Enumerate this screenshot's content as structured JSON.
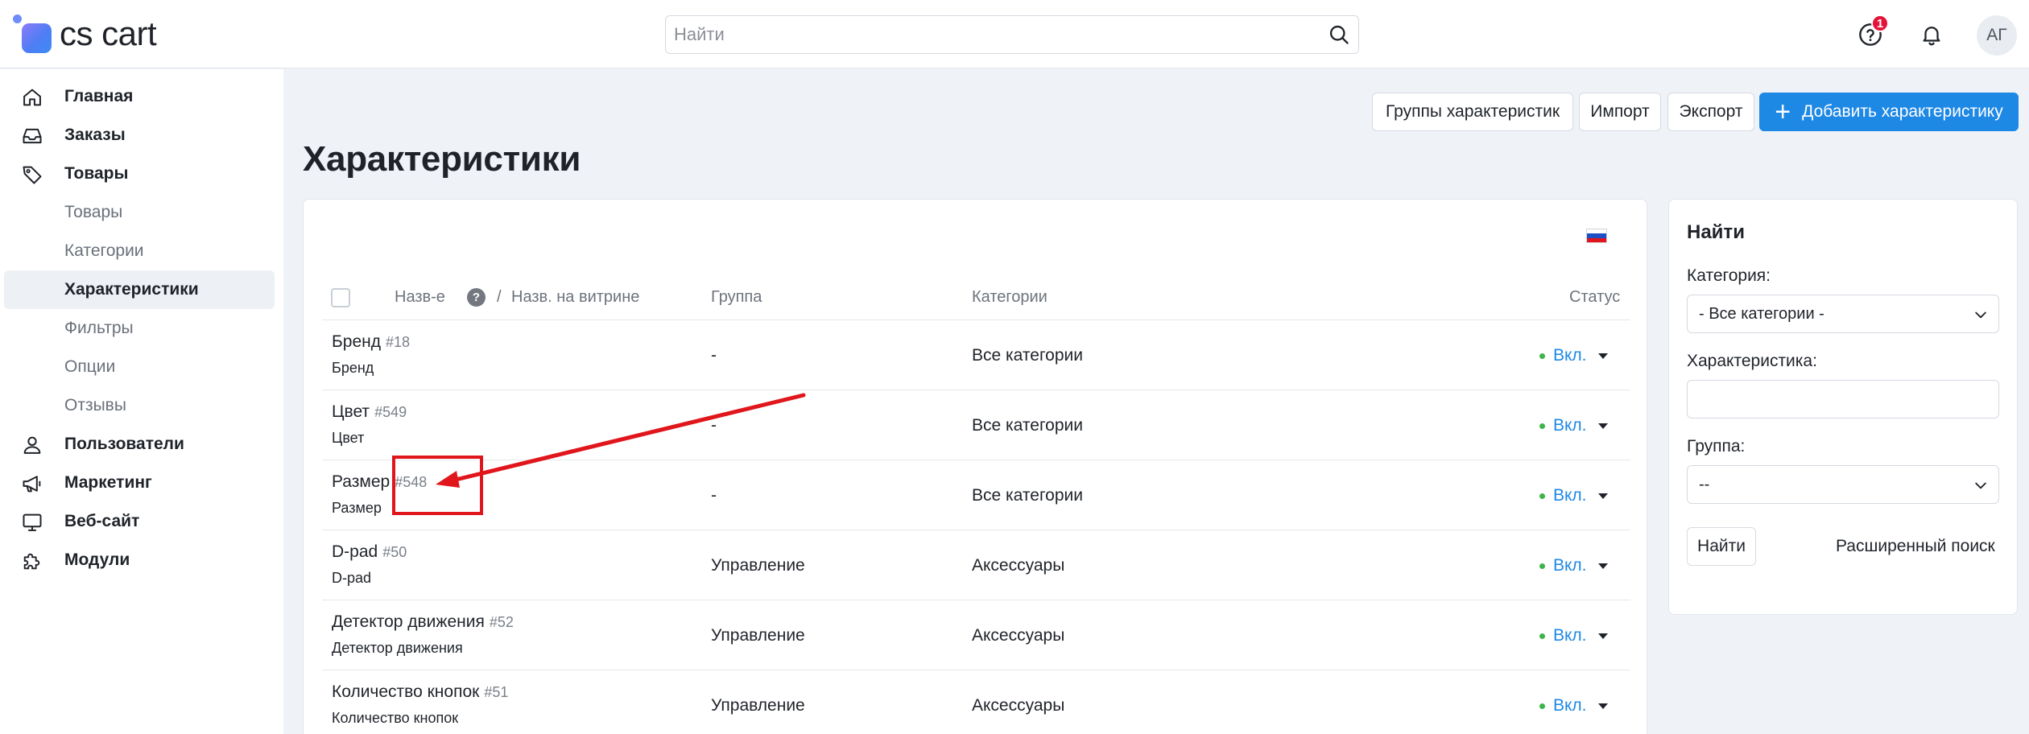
{
  "brand": {
    "logo_text": "cs cart"
  },
  "header": {
    "search_placeholder": "Найти",
    "help_badge": "1",
    "avatar_initials": "АГ"
  },
  "sidebar": {
    "items": [
      {
        "label": "Главная",
        "icon": "home-icon"
      },
      {
        "label": "Заказы",
        "icon": "inbox-icon"
      },
      {
        "label": "Товары",
        "icon": "tag-icon"
      },
      {
        "label": "Товары",
        "sub": true
      },
      {
        "label": "Категории",
        "sub": true
      },
      {
        "label": "Характеристики",
        "sub": true,
        "active": true
      },
      {
        "label": "Фильтры",
        "sub": true
      },
      {
        "label": "Опции",
        "sub": true
      },
      {
        "label": "Отзывы",
        "sub": true
      },
      {
        "label": "Пользователи",
        "icon": "user-icon"
      },
      {
        "label": "Маркетинг",
        "icon": "megaphone-icon"
      },
      {
        "label": "Веб-сайт",
        "icon": "monitor-icon"
      },
      {
        "label": "Модули",
        "icon": "puzzle-icon"
      }
    ]
  },
  "toolbar": {
    "groups_label": "Группы характеристик",
    "import_label": "Импорт",
    "export_label": "Экспорт",
    "add_label": "Добавить характеристику"
  },
  "page": {
    "title": "Характеристики"
  },
  "table": {
    "headers": {
      "name": "Назв-е",
      "separator": "/",
      "storefront_name": "Назв. на витрине",
      "group": "Группа",
      "categories": "Категории",
      "status": "Статус"
    },
    "rows": [
      {
        "name": "Бренд",
        "id": "#18",
        "sub": "Бренд",
        "group": "-",
        "categories": "Все категории",
        "status": "Вкл."
      },
      {
        "name": "Цвет",
        "id": "#549",
        "sub": "Цвет",
        "group": "-",
        "categories": "Все категории",
        "status": "Вкл."
      },
      {
        "name": "Размер",
        "id": "#548",
        "sub": "Размер",
        "group": "-",
        "categories": "Все категории",
        "status": "Вкл."
      },
      {
        "name": "D-pad",
        "id": "#50",
        "sub": "D-pad",
        "group": "Управление",
        "categories": "Аксессуары",
        "status": "Вкл."
      },
      {
        "name": "Детектор движения",
        "id": "#52",
        "sub": "Детектор движения",
        "group": "Управление",
        "categories": "Аксессуары",
        "status": "Вкл."
      },
      {
        "name": "Количество кнопок",
        "id": "#51",
        "sub": "Количество кнопок",
        "group": "Управление",
        "categories": "Аксессуары",
        "status": "Вкл."
      }
    ]
  },
  "search_panel": {
    "title": "Найти",
    "category_label": "Категория:",
    "category_value": "- Все категории -",
    "feature_label": "Характеристика:",
    "feature_value": "",
    "group_label": "Группа:",
    "group_value": "--",
    "find_button": "Найти",
    "advanced_link": "Расширенный поиск"
  },
  "colors": {
    "accent": "#1e88e5",
    "status_on": "#3db44a",
    "annotation": "#e0161c",
    "badge": "#e5133a"
  }
}
